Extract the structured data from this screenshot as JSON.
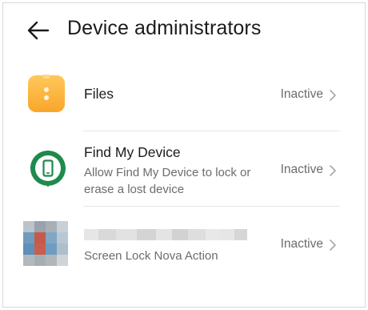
{
  "header": {
    "title": "Device administrators"
  },
  "items": [
    {
      "title": "Files",
      "subtitle": "",
      "status": "Inactive",
      "icon": "files-app-icon"
    },
    {
      "title": "Find My Device",
      "subtitle": "Allow Find My Device to lock or erase a lost device",
      "status": "Inactive",
      "icon": "find-my-device-icon"
    },
    {
      "title": "",
      "subtitle": "Screen Lock Nova Action",
      "status": "Inactive",
      "icon": "pixelated-app-icon"
    }
  ],
  "colors": {
    "files_icon": "#fbb23a",
    "find_my_device": "#1e8a4c",
    "status_text": "#6c6c6c",
    "chevron": "#a8a8a8"
  }
}
